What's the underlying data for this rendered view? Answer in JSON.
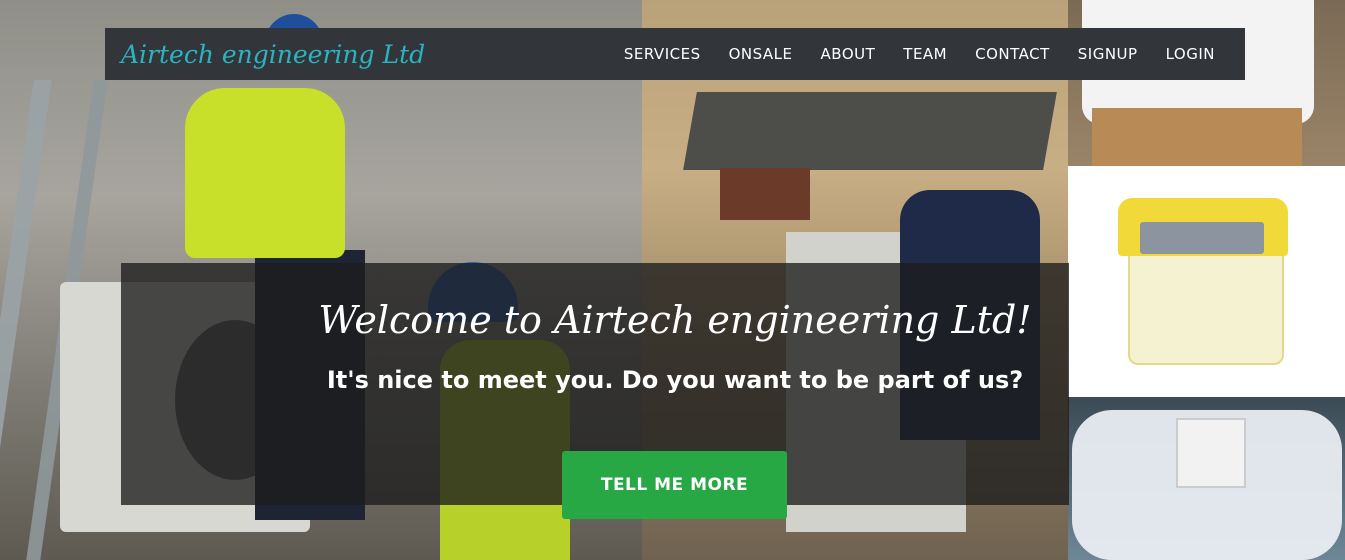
{
  "brand": {
    "name": "Airtech engineering Ltd"
  },
  "nav": {
    "items": [
      {
        "label": "SERVICES"
      },
      {
        "label": "ONSALE"
      },
      {
        "label": "ABOUT"
      },
      {
        "label": "TEAM"
      },
      {
        "label": "CONTACT"
      },
      {
        "label": "SIGNUP"
      },
      {
        "label": "LOGIN"
      }
    ]
  },
  "hero": {
    "welcome": "Welcome to Airtech engineering Ltd!",
    "lead": "It's nice to meet you. Do you want to be part of us?",
    "cta_label": "TELL ME MORE"
  },
  "colors": {
    "navbar_bg": "#32363b",
    "brand_text": "#2bb3c0",
    "cta_bg": "#28a745",
    "overlay_bg": "rgba(28,28,28,0.78)"
  }
}
